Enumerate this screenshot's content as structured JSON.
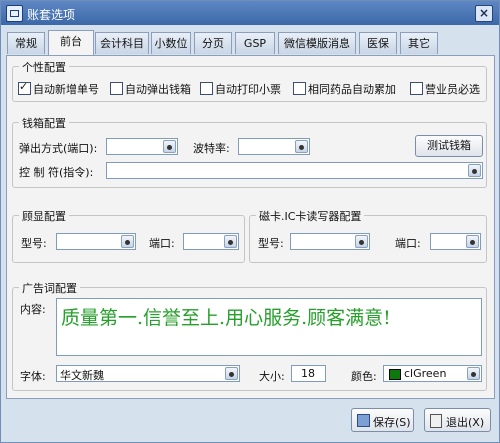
{
  "window": {
    "title": "账套选项",
    "close_glyph": "×"
  },
  "tabs": [
    {
      "label": "常规"
    },
    {
      "label": "前台"
    },
    {
      "label": "会计科目"
    },
    {
      "label": "小数位"
    },
    {
      "label": "分页"
    },
    {
      "label": "GSP"
    },
    {
      "label": "微信模版消息"
    },
    {
      "label": "医保"
    },
    {
      "label": "其它"
    }
  ],
  "personal": {
    "title": "个性配置",
    "options": [
      {
        "label": "自动新增单号",
        "checked": true
      },
      {
        "label": "自动弹出钱箱",
        "checked": false
      },
      {
        "label": "自动打印小票",
        "checked": false
      },
      {
        "label": "相同药品自动累加",
        "checked": false
      },
      {
        "label": "营业员必选",
        "checked": false
      }
    ]
  },
  "cashbox": {
    "title": "钱箱配置",
    "popup_label": "弹出方式(端口):",
    "popup_value": "",
    "baud_label": "波特率:",
    "baud_value": "",
    "test_button": "测试钱箱",
    "command_label": "控 制 符(指令):",
    "command_value": ""
  },
  "display": {
    "title": "顾显配置",
    "model_label": "型号:",
    "model_value": "",
    "port_label": "端口:",
    "port_value": ""
  },
  "reader": {
    "title": "磁卡.IC卡读写器配置",
    "model_label": "型号:",
    "model_value": "",
    "port_label": "端口:",
    "port_value": ""
  },
  "ad": {
    "title": "广告词配置",
    "content_label": "内容:",
    "content": "质量第一.信誉至上.用心服务.顾客满意!",
    "font_label": "字体:",
    "font_value": "华文新魏",
    "size_label": "大小:",
    "size_value": "18",
    "color_label": "颜色:",
    "color_value": "clGreen",
    "swatch_color": "#0b7a0b"
  },
  "footer": {
    "save": "保存(S)",
    "exit": "退出(X)"
  }
}
